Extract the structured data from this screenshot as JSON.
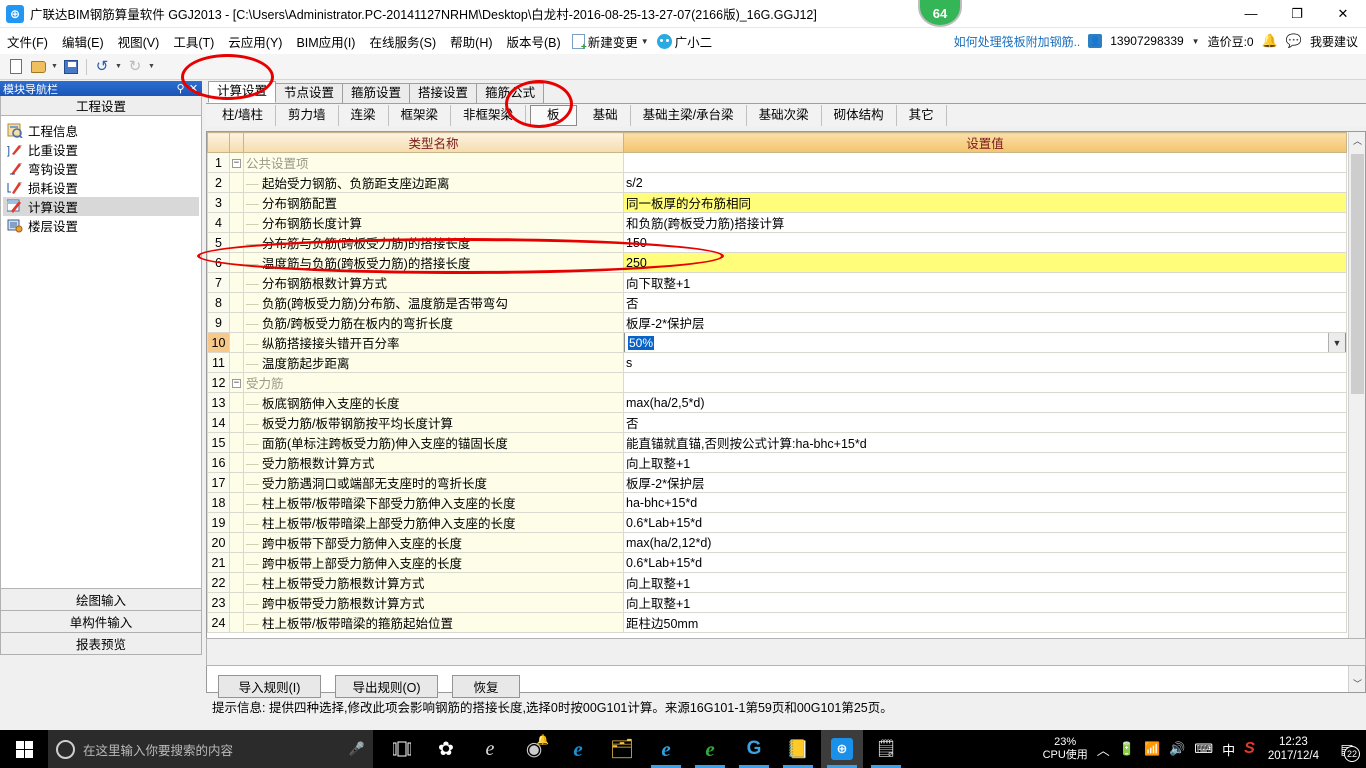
{
  "titlebar": {
    "app_icon": "app-logo-icon",
    "title": "广联达BIM钢筋算量软件 GGJ2013 - [C:\\Users\\Administrator.PC-20141127NRHM\\Desktop\\白龙村-2016-08-25-13-27-07(2166版)_16G.GGJ12]",
    "minimize": "—",
    "maximize": "❐",
    "close": "✕",
    "badge_count": "64"
  },
  "menubar": {
    "items": [
      {
        "label": "文件(F)"
      },
      {
        "label": "编辑(E)"
      },
      {
        "label": "视图(V)"
      },
      {
        "label": "工具(T)"
      },
      {
        "label": "云应用(Y)"
      },
      {
        "label": "BIM应用(I)"
      },
      {
        "label": "在线服务(S)"
      },
      {
        "label": "帮助(H)"
      },
      {
        "label": "版本号(B)"
      }
    ],
    "new_change": "新建变更",
    "assistant": "广小二",
    "right": {
      "help_link": "如何处理筏板附加钢筋..",
      "account": "13907298339",
      "coins": "造价豆:0",
      "suggest": "我要建议"
    }
  },
  "toolbar": {
    "new": "new-file-icon",
    "open": "open-folder-icon",
    "save": "save-icon",
    "undo": "undo-icon",
    "redo": "redo-icon"
  },
  "left_panel": {
    "header_title": "模块导航栏",
    "pin": "📌",
    "close": "✕",
    "group_title": "工程设置",
    "items": [
      {
        "label": "工程信息",
        "selected": false
      },
      {
        "label": "比重设置",
        "selected": false
      },
      {
        "label": "弯钩设置",
        "selected": false
      },
      {
        "label": "损耗设置",
        "selected": false
      },
      {
        "label": "计算设置",
        "selected": true
      },
      {
        "label": "楼层设置",
        "selected": false
      }
    ],
    "bottom_buttons": [
      {
        "label": "绘图输入"
      },
      {
        "label": "单构件输入"
      },
      {
        "label": "报表预览"
      }
    ]
  },
  "tabs_primary": [
    {
      "label": "计算设置",
      "active": true
    },
    {
      "label": "节点设置",
      "active": false
    },
    {
      "label": "箍筋设置",
      "active": false
    },
    {
      "label": "搭接设置",
      "active": false
    },
    {
      "label": "箍筋公式",
      "active": false
    }
  ],
  "tabs_secondary": [
    {
      "label": "柱/墙柱",
      "active": false
    },
    {
      "label": "剪力墙",
      "active": false
    },
    {
      "label": "连梁",
      "active": false
    },
    {
      "label": "框架梁",
      "active": false
    },
    {
      "label": "非框架梁",
      "active": false
    },
    {
      "label": "板",
      "active": true
    },
    {
      "label": "基础",
      "active": false
    },
    {
      "label": "基础主梁/承台梁",
      "active": false
    },
    {
      "label": "基础次梁",
      "active": false
    },
    {
      "label": "砌体结构",
      "active": false
    },
    {
      "label": "其它",
      "active": false
    }
  ],
  "grid": {
    "headers": {
      "name": "类型名称",
      "value": "设置值"
    },
    "rows": [
      {
        "num": "1",
        "type": "group",
        "name": "公共设置项",
        "value": ""
      },
      {
        "num": "2",
        "type": "item",
        "name": "起始受力钢筋、负筋距支座边距离",
        "value": "s/2"
      },
      {
        "num": "3",
        "type": "item",
        "name": "分布钢筋配置",
        "value": "同一板厚的分布筋相同",
        "highlight": true
      },
      {
        "num": "4",
        "type": "item",
        "name": "分布钢筋长度计算",
        "value": "和负筋(跨板受力筋)搭接计算"
      },
      {
        "num": "5",
        "type": "item",
        "name": "分布筋与负筋(跨板受力筋)的搭接长度",
        "value": "150"
      },
      {
        "num": "6",
        "type": "item",
        "name": "温度筋与负筋(跨板受力筋)的搭接长度",
        "value": "250",
        "highlight": true
      },
      {
        "num": "7",
        "type": "item",
        "name": "分布钢筋根数计算方式",
        "value": "向下取整+1"
      },
      {
        "num": "8",
        "type": "item",
        "name": "负筋(跨板受力筋)分布筋、温度筋是否带弯勾",
        "value": "否"
      },
      {
        "num": "9",
        "type": "item",
        "name": "负筋/跨板受力筋在板内的弯折长度",
        "value": "板厚-2*保护层"
      },
      {
        "num": "10",
        "type": "item",
        "name": "纵筋搭接接头错开百分率",
        "value": "50%",
        "editing": true,
        "row_selected": true
      },
      {
        "num": "11",
        "type": "item",
        "name": "温度筋起步距离",
        "value": "s"
      },
      {
        "num": "12",
        "type": "group",
        "name": "受力筋",
        "value": ""
      },
      {
        "num": "13",
        "type": "item",
        "name": "板底钢筋伸入支座的长度",
        "value": "max(ha/2,5*d)"
      },
      {
        "num": "14",
        "type": "item",
        "name": "板受力筋/板带钢筋按平均长度计算",
        "value": "否"
      },
      {
        "num": "15",
        "type": "item",
        "name": "面筋(单标注跨板受力筋)伸入支座的锚固长度",
        "value": "能直锚就直锚,否则按公式计算:ha-bhc+15*d"
      },
      {
        "num": "16",
        "type": "item",
        "name": "受力筋根数计算方式",
        "value": "向上取整+1"
      },
      {
        "num": "17",
        "type": "item",
        "name": "受力筋遇洞口或端部无支座时的弯折长度",
        "value": "板厚-2*保护层"
      },
      {
        "num": "18",
        "type": "item",
        "name": "柱上板带/板带暗梁下部受力筋伸入支座的长度",
        "value": "ha-bhc+15*d"
      },
      {
        "num": "19",
        "type": "item",
        "name": "柱上板带/板带暗梁上部受力筋伸入支座的长度",
        "value": "0.6*Lab+15*d"
      },
      {
        "num": "20",
        "type": "item",
        "name": "跨中板带下部受力筋伸入支座的长度",
        "value": "max(ha/2,12*d)"
      },
      {
        "num": "21",
        "type": "item",
        "name": "跨中板带上部受力筋伸入支座的长度",
        "value": "0.6*Lab+15*d"
      },
      {
        "num": "22",
        "type": "item",
        "name": "柱上板带受力筋根数计算方式",
        "value": "向上取整+1"
      },
      {
        "num": "23",
        "type": "item",
        "name": "跨中板带受力筋根数计算方式",
        "value": "向上取整+1"
      },
      {
        "num": "24",
        "type": "item",
        "name": "柱上板带/板带暗梁的箍筋起始位置",
        "value": "距柱边50mm"
      }
    ],
    "scrollbar": {
      "up": "︿",
      "down": "﹀"
    }
  },
  "hint": {
    "label": "提示信息:",
    "text": "提供四种选择,修改此项会影响钢筋的搭接长度,选择0时按00G101计算。来源16G101-1第59页和00G101第25页。"
  },
  "footer_buttons": [
    {
      "label": "导入规则(I)"
    },
    {
      "label": "导出规则(O)"
    },
    {
      "label": "恢复"
    }
  ],
  "taskbar": {
    "search_placeholder": "在这里输入你要搜索的内容",
    "cpu_percent": "23%",
    "cpu_label": "CPU使用",
    "time": "12:23",
    "date": "2017/12/4",
    "notification_count": "22",
    "ime": "中"
  }
}
